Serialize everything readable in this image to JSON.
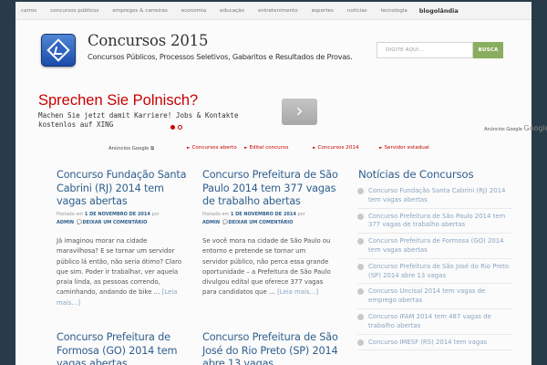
{
  "topnav": {
    "items": [
      "carros",
      "concursos públicos",
      "empregos & carreiras",
      "economia",
      "educação",
      "entretenimento",
      "esportes",
      "notícias",
      "tecnologia"
    ],
    "brand": "blogolândia"
  },
  "header": {
    "title": "Concursos 2015",
    "description": "Concursos Públicos, Processos Seletivos, Gabaritos e Resultados de Provas.",
    "search_placeholder": "DIGITE AQUI...",
    "search_button": "BUSCA"
  },
  "ad": {
    "title": "Sprechen Sie Polnisch?",
    "text_line1": "Machen Sie jetzt damit Karriere! Jobs & Kontakte",
    "text_line2": "kostenlos auf XING",
    "arrow": "›",
    "google_label": "Anúncios Google",
    "google_logo": "Google"
  },
  "adlinks": {
    "label": "Anúncios Google",
    "items": [
      "Concursos aberto",
      "Edital concurso",
      "Concursos 2014",
      "Servidor estadual"
    ]
  },
  "posts": [
    {
      "title": "Concurso Fundação Santa Cabrini (RJ) 2014 tem vagas abertas",
      "meta_prefix": "Postado em",
      "date": "1 DE NOVEMBRO DE 2014",
      "by": "por",
      "author": "ADMIN",
      "comment": "DEIXAR UM COMENTÁRIO",
      "excerpt": "Já imaginou morar na cidade maravilhosa? E se tornar um servidor público lá então, não seria ótimo? Claro que sim. Poder ir trabalhar, ver aquela praia linda, as pessoas correndo, caminhando, andando de bike …",
      "more": "[Leia mais…]"
    },
    {
      "title": "Concurso Prefeitura de São Paulo 2014 tem 377 vagas de trabalho abertas",
      "meta_prefix": "Postado em",
      "date": "1 DE NOVEMBRO DE 2014",
      "by": "por",
      "author": "ADMIN",
      "comment": "DEIXAR UM COMENTÁRIO",
      "excerpt": "Se você mora na cidade de São Paulo ou entorno e pretende se tornar um servidor público, não perca essa grande oportunidade – a Prefeitura de São Paulo divulgou edital que oferece 377 vagas para candidatos que …",
      "more": "[Leia mais…]"
    },
    {
      "title": "Concurso Prefeitura de Formosa (GO) 2014 tem vagas abertas"
    },
    {
      "title": "Concurso Prefeitura de São José do Rio Preto (SP) 2014 abre 13 vagas"
    }
  ],
  "sidebar": {
    "title": "Notícias de Concursos",
    "items": [
      "Concurso Fundação Santa Cabrini (RJ) 2014 tem vagas abertas",
      "Concurso Prefeitura de São Paulo 2014 tem 377 vagas de trabalho abertas",
      "Concurso Prefeitura de Formosa (GO) 2014 tem vagas abertas",
      "Concurso Prefeitura de São José do Rio Preto (SP) 2014 abre 13 vagas",
      "Concurso Uncisal 2014 tem vagas de emprego abertas",
      "Concurso IFAM 2014 tem 487 vagas de trabalho abertas",
      "Concurso IMESF (RS) 2014 tem vagas"
    ]
  }
}
